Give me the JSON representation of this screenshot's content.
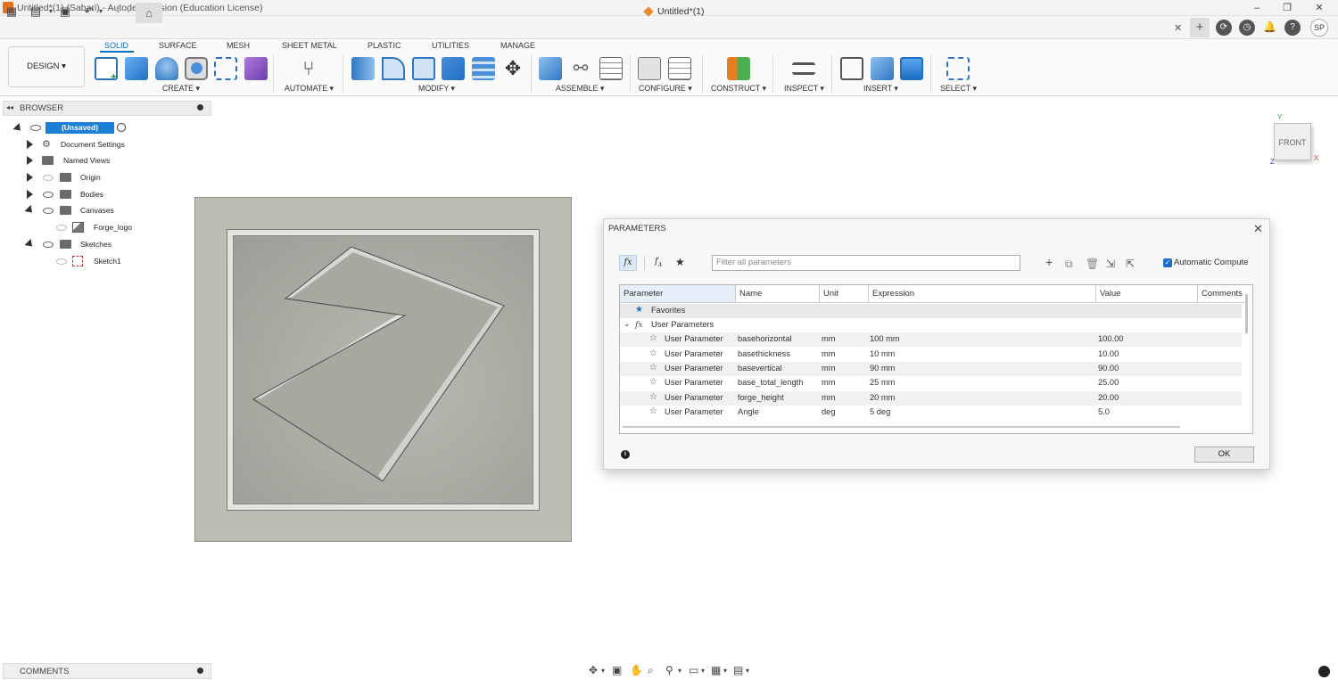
{
  "window": {
    "title": "Untitled*(1) (Sabari) - Autodesk Fusion (Education License)",
    "minimize": "–",
    "restore": "❐",
    "close": "✕"
  },
  "quick_access": {
    "document_tab": "Untitled*(1)",
    "user_initials": "SP"
  },
  "ribbon": {
    "workspace": "DESIGN ▾",
    "tabs": [
      "SOLID",
      "SURFACE",
      "MESH",
      "SHEET METAL",
      "PLASTIC",
      "UTILITIES",
      "MANAGE"
    ],
    "groups": [
      "CREATE ▾",
      "AUTOMATE ▾",
      "MODIFY ▾",
      "ASSEMBLE ▾",
      "CONFIGURE ▾",
      "CONSTRUCT ▾",
      "INSPECT ▾",
      "INSERT ▾",
      "SELECT ▾"
    ]
  },
  "browser": {
    "title": "BROWSER",
    "root": "(Unsaved)",
    "items": [
      "Document Settings",
      "Named Views",
      "Origin",
      "Bodies",
      "Canvases",
      "Forge_logo",
      "Sketches",
      "Sketch1"
    ]
  },
  "viewcube": {
    "face": "FRONT",
    "axis_y": "Y",
    "axis_x": "X",
    "axis_z": "Z"
  },
  "parameters_dialog": {
    "title": "PARAMETERS",
    "filter_placeholder": "Filter all parameters",
    "auto_compute_label": "Automatic Compute",
    "auto_compute_checked": true,
    "columns": [
      "Parameter",
      "Name",
      "Unit",
      "Expression",
      "Value",
      "Comments"
    ],
    "favorites_label": "Favorites",
    "user_params_label": "User Parameters",
    "rows": [
      {
        "type": "User Parameter",
        "name": "basehorizontal",
        "unit": "mm",
        "expression": "100 mm",
        "value": "100.00"
      },
      {
        "type": "User Parameter",
        "name": "basethickness",
        "unit": "mm",
        "expression": "10 mm",
        "value": "10.00"
      },
      {
        "type": "User Parameter",
        "name": "basevertical",
        "unit": "mm",
        "expression": "90 mm",
        "value": "90.00"
      },
      {
        "type": "User Parameter",
        "name": "base_total_length",
        "unit": "mm",
        "expression": "25 mm",
        "value": "25.00"
      },
      {
        "type": "User Parameter",
        "name": "forge_height",
        "unit": "mm",
        "expression": "20 mm",
        "value": "20.00"
      },
      {
        "type": "User Parameter",
        "name": "Angle",
        "unit": "deg",
        "expression": "5 deg",
        "value": "5.0"
      }
    ],
    "ok_label": "OK"
  },
  "bottom": {
    "comments_label": "COMMENTS"
  }
}
